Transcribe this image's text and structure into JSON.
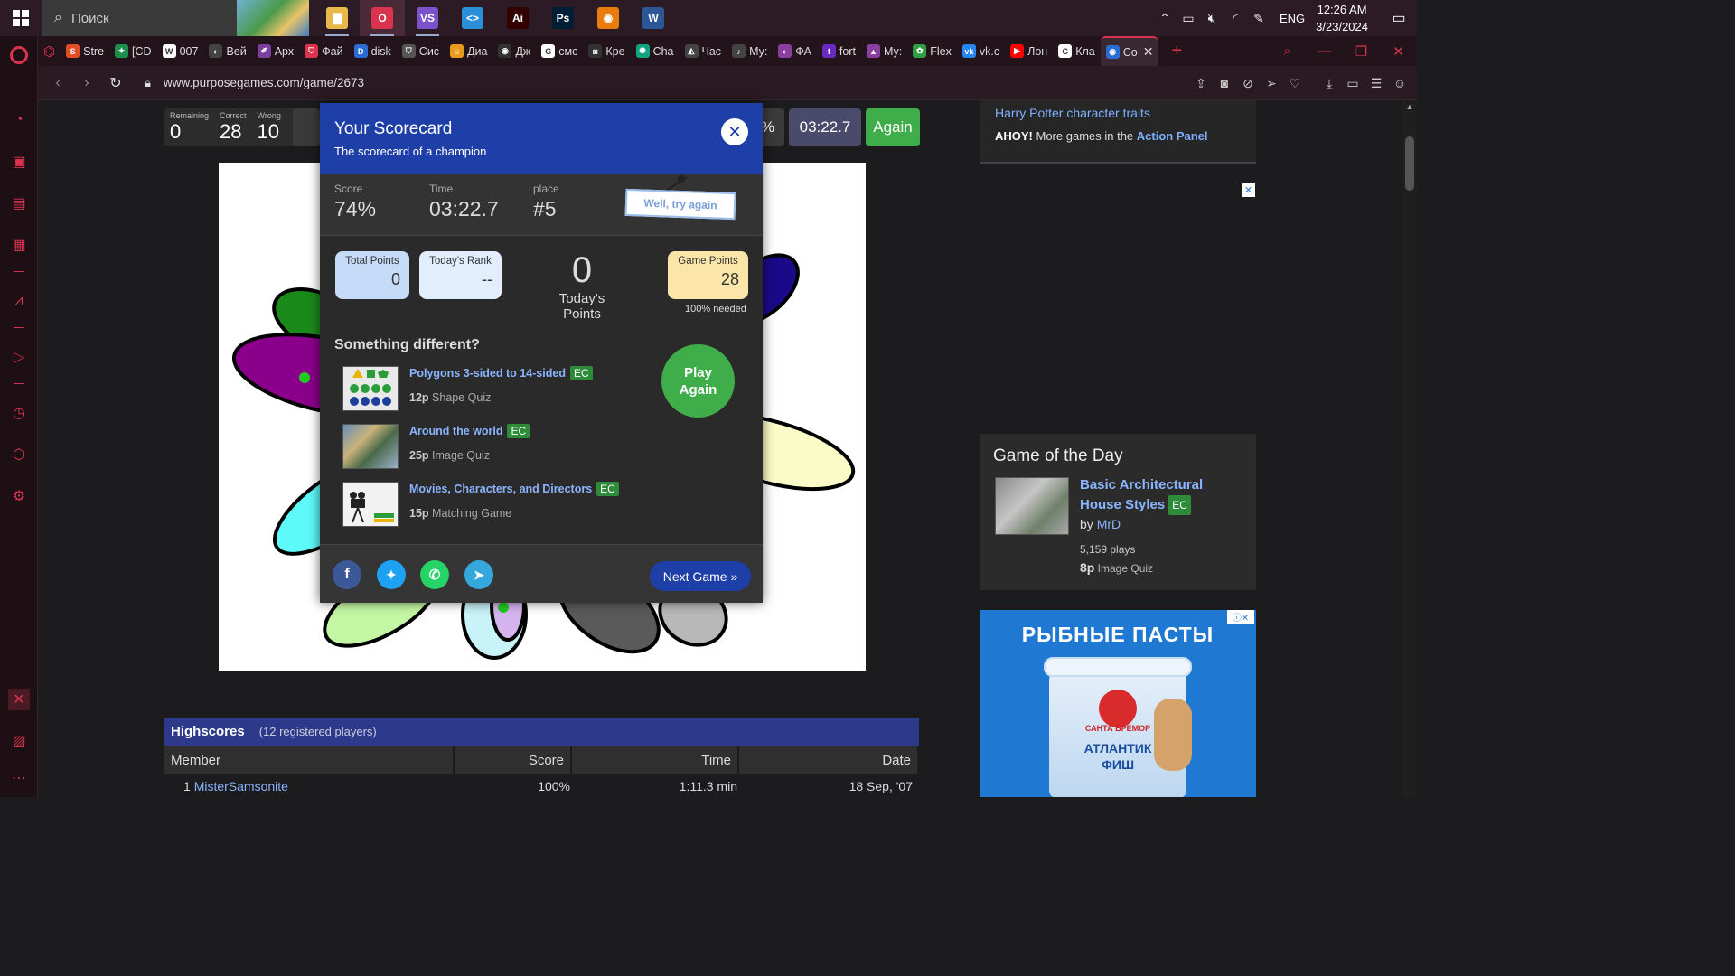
{
  "taskbar": {
    "search_placeholder": "Поиск",
    "apps": [
      {
        "name": "file-explorer",
        "color": "#e8b84a",
        "glyph": "▇"
      },
      {
        "name": "opera",
        "color": "#d8344e",
        "glyph": "O"
      },
      {
        "name": "visual-studio",
        "color": "#7b52c9",
        "glyph": "VS"
      },
      {
        "name": "vscode",
        "color": "#2a8fd8",
        "glyph": "<>"
      },
      {
        "name": "illustrator",
        "color": "#330000",
        "glyph": "Ai"
      },
      {
        "name": "photoshop",
        "color": "#001e36",
        "glyph": "Ps"
      },
      {
        "name": "blender",
        "color": "#e87d0d",
        "glyph": "◉"
      },
      {
        "name": "word",
        "color": "#2b5797",
        "glyph": "W"
      }
    ],
    "lang": "ENG",
    "time": "12:26 AM",
    "date": "3/23/2024"
  },
  "tabs": [
    {
      "label": "Stre",
      "color": "#e44d26",
      "glyph": "S"
    },
    {
      "label": "[CD",
      "color": "#1b8f4c",
      "glyph": "✦"
    },
    {
      "label": "007",
      "color": "#ffffff",
      "glyph": "W"
    },
    {
      "label": "Вей",
      "color": "#444444",
      "glyph": "◐"
    },
    {
      "label": "Арх",
      "color": "#7a3fa0",
      "glyph": "✐"
    },
    {
      "label": "Фай",
      "color": "#d8344e",
      "glyph": "⛉"
    },
    {
      "label": "disk",
      "color": "#2a6bd6",
      "glyph": "D"
    },
    {
      "label": "Сис",
      "color": "#555555",
      "glyph": "⛉"
    },
    {
      "label": "Диа",
      "color": "#e89a1a",
      "glyph": "☺"
    },
    {
      "label": "Дж",
      "color": "#333333",
      "glyph": "◉"
    },
    {
      "label": "смс",
      "color": "#ffffff",
      "glyph": "G"
    },
    {
      "label": "Кре",
      "color": "#333333",
      "glyph": "◙"
    },
    {
      "label": "Cha",
      "color": "#10a37f",
      "glyph": "✺"
    },
    {
      "label": "Час",
      "color": "#444444",
      "glyph": "◭"
    },
    {
      "label": "Му:",
      "color": "#444444",
      "glyph": "♪"
    },
    {
      "label": "ФА",
      "color": "#8a3fa0",
      "glyph": "◐"
    },
    {
      "label": "fort",
      "color": "#6a2ac0",
      "glyph": "f"
    },
    {
      "label": "Му:",
      "color": "#8a3fa0",
      "glyph": "▲"
    },
    {
      "label": "Flex",
      "color": "#2ea043",
      "glyph": "✿"
    },
    {
      "label": "vk.c",
      "color": "#2787f5",
      "glyph": "vk"
    },
    {
      "label": "Лон",
      "color": "#ff0000",
      "glyph": "▶"
    },
    {
      "label": "Кла",
      "color": "#ffffff",
      "glyph": "C"
    },
    {
      "label": "Co",
      "color": "#2a6bd6",
      "glyph": "◉",
      "active": true
    }
  ],
  "address": {
    "url": "www.purposegames.com/game/2673"
  },
  "game_stats": {
    "remaining_label": "Remaining",
    "remaining": "0",
    "correct_label": "Correct",
    "correct": "28",
    "wrong_label": "Wrong",
    "wrong": "10",
    "percent": "%",
    "time": "03:22.7",
    "again": "Again"
  },
  "modal": {
    "title": "Your Scorecard",
    "subtitle": "The scorecard of a champion",
    "close": "✕",
    "score_label": "Score",
    "score": "74%",
    "time_label": "Time",
    "time": "03:22.7",
    "place_label": "place",
    "place": "#5",
    "sign": "Well, try again",
    "total_points_label": "Total Points",
    "total_points": "0",
    "todays_rank_label": "Today's Rank",
    "todays_rank": "--",
    "todays_points": "0",
    "todays_points_label": "Today's Points",
    "game_points_label": "Game Points",
    "game_points": "28",
    "needed": "100% needed",
    "something_different": "Something different?",
    "suggestions": [
      {
        "title": "Polygons 3-sided to 14-sided",
        "ec": "EC",
        "points": "12p",
        "type": "Shape Quiz"
      },
      {
        "title": "Around the world",
        "ec": "EC",
        "points": "25p",
        "type": "Image Quiz"
      },
      {
        "title": "Movies, Characters, and Directors",
        "ec": "EC",
        "points": "15p",
        "type": "Matching Game"
      }
    ],
    "play_again_1": "Play",
    "play_again_2": "Again",
    "next_game": "Next Game »"
  },
  "right": {
    "link": "Harry Potter character traits",
    "ahoy": "AHOY!",
    "ahoy_text": " More games in the ",
    "action_panel": "Action Panel",
    "gotd_title": "Game of the Day",
    "gotd_game": "Basic Architectural House Styles",
    "gotd_ec": "EC",
    "gotd_by": "by ",
    "gotd_author": "MrD",
    "gotd_plays": "5,159 plays",
    "gotd_points": "8p",
    "gotd_type": " Image Quiz",
    "ad_title": "РЫБНЫЕ ПАСТЫ",
    "ad_brand": "САНТА БРЕМОР",
    "ad_product_1": "АТЛАНТИК",
    "ad_product_2": "ФИШ"
  },
  "highscores": {
    "title": "Highscores",
    "registered": "(12 registered players)",
    "columns": [
      "Member",
      "Score",
      "Time",
      "Date"
    ],
    "rows": [
      {
        "rank": "1",
        "member": "MisterSamsonite",
        "score": "100%",
        "time": "1:11.3 min",
        "date": "18 Sep, '07"
      }
    ]
  }
}
